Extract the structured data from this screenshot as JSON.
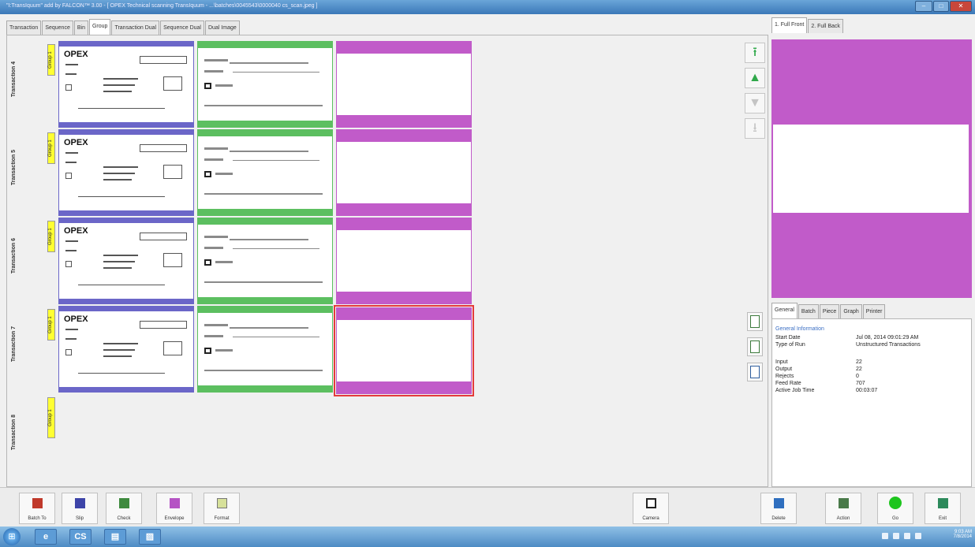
{
  "window": {
    "title": "\"I:TransIquum\" add by FALCON™ 3.00 - [ OPEX Technical scanning TransIquum - ...\\batches\\0045543\\0000040 cs_scan.jpeg ]",
    "minimize": "–",
    "maximize": "□",
    "close": "✕"
  },
  "tabs": [
    "Transaction",
    "Sequence",
    "Bin",
    "Group",
    "Transaction Dual",
    "Sequence Dual",
    "Dual Image"
  ],
  "active_tab": "Group",
  "transactions": [
    {
      "label": "Transaction 4",
      "group": "Group 1"
    },
    {
      "label": "Transaction 5",
      "group": "Group 1"
    },
    {
      "label": "Transaction 6",
      "group": "Group 1"
    },
    {
      "label": "Transaction 7",
      "group": "Group 1"
    },
    {
      "label": "Transaction 8",
      "group": "Group 1"
    }
  ],
  "slip_logo": "OPEX",
  "navigation": {
    "first": "⭱",
    "prev": "▲",
    "next": "▼",
    "last": "⭳"
  },
  "right_tabs": [
    "1. Full Front",
    "2. Full Back"
  ],
  "info_tabs": [
    "General",
    "Batch",
    "Piece",
    "Graph",
    "Printer"
  ],
  "general_info": {
    "header": "General Information",
    "rows": [
      {
        "label": "Start Date",
        "value": "Jul 08, 2014 09:01:29 AM"
      },
      {
        "label": "Type of Run",
        "value": "Unstructured Transactions"
      },
      {
        "label": "Input",
        "value": "22"
      },
      {
        "label": "Output",
        "value": "22"
      },
      {
        "label": "Rejects",
        "value": "0"
      },
      {
        "label": "Feed Rate",
        "value": "707"
      },
      {
        "label": "Active Job Time",
        "value": "00:03:07"
      }
    ]
  },
  "toolbar": [
    {
      "name": "batch-to-button",
      "label": "Batch To",
      "color": "#c0392b"
    },
    {
      "name": "slip-button",
      "label": "Slip",
      "color": "#3d44a8"
    },
    {
      "name": "check-button",
      "label": "Check",
      "color": "#3e8a3e"
    },
    {
      "name": "envelope-button",
      "label": "Envelope",
      "color": "#b554c4"
    },
    {
      "name": "format-button",
      "label": "Format",
      "color": "#d7e19a"
    },
    {
      "name": "camera-button",
      "label": "Camera",
      "color": "#222222"
    },
    {
      "name": "delete-button",
      "label": "Delete",
      "color": "#2f6fbf"
    },
    {
      "name": "action-button",
      "label": "Action",
      "color": "#4a7a4a"
    },
    {
      "name": "go-button",
      "label": "Go",
      "color": "#1ec51e"
    },
    {
      "name": "exit-button",
      "label": "Exit",
      "color": "#2d8a5c"
    }
  ],
  "taskbar": {
    "start": "⊞",
    "apps": [
      "e",
      "CS",
      "▤",
      "▨"
    ],
    "time": "9:03 AM",
    "date": "7/8/2014"
  },
  "colors": {
    "slip": "#6b66c8",
    "check": "#5cbf60",
    "envelope": "#c15bc9",
    "selection": "#e43b3b"
  }
}
